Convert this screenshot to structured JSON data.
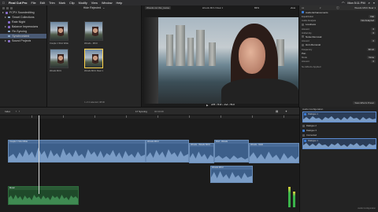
{
  "menubar": {
    "apple": "",
    "items": [
      "Final Cut Pro",
      "File",
      "Edit",
      "Trim",
      "Mark",
      "Clip",
      "Modify",
      "View",
      "Window",
      "Help"
    ],
    "clock": "Mon 5:11 PM"
  },
  "libraries": {
    "items": [
      {
        "label": "FCPX Soundediting",
        "level": 0
      },
      {
        "label": "Smart Collections",
        "level": 1
      },
      {
        "label": "Rate Night",
        "level": 1
      },
      {
        "label": "Balance Impressions",
        "level": 1
      },
      {
        "label": "Re-Syncing",
        "level": 2
      },
      {
        "label": "Synchronized",
        "level": 2
      },
      {
        "label": "Sound Projects",
        "level": 1
      }
    ],
    "selected_index": 5
  },
  "browser": {
    "title": "Hide Rejected",
    "clips": [
      {
        "label": "Couple 1 Shot Wide"
      },
      {
        "label": "Woods - MCU"
      },
      {
        "label": "Woods MCU"
      },
      {
        "label": "Woods MCU Rear 1"
      }
    ],
    "footer": "1 of 4 selected, 08:00"
  },
  "viewer": {
    "zoom": "83%",
    "view_label": "View",
    "title_left": "Woods cut this_louise",
    "title_right": "Woods MCU Rear 1",
    "timecode": "18:53:32:03"
  },
  "inspector": {
    "title": "Woods MCU Rear 1",
    "sections": [
      {
        "type": "head",
        "label": "Audio Enhancements"
      },
      {
        "type": "row",
        "label": "Equalization",
        "value": "Flat"
      },
      {
        "type": "row",
        "label": "Audio Analysis",
        "value": "Not Analyzed"
      },
      {
        "type": "head",
        "label": "Loudness"
      },
      {
        "type": "row",
        "label": "Amount",
        "value": "0"
      },
      {
        "type": "row",
        "label": "Uniformity",
        "value": "0"
      },
      {
        "type": "head",
        "label": "Noise Removal"
      },
      {
        "type": "row",
        "label": "Amount",
        "value": "0"
      },
      {
        "type": "head",
        "label": "Hum Removal"
      },
      {
        "type": "row",
        "label": "Frequency",
        "value": "60 Hz"
      },
      {
        "type": "head",
        "label": "Pan"
      },
      {
        "type": "row",
        "label": "Mode",
        "value": "None"
      },
      {
        "type": "row",
        "label": "Amount",
        "value": "0"
      },
      {
        "type": "head",
        "label": "No Effects Applied"
      }
    ],
    "save_preset": "Save Effects Preset"
  },
  "timeline_bar": {
    "index_label": "Index",
    "project_label": "17 Syncing",
    "duration": "00:00:08"
  },
  "timeline": {
    "clips": [
      {
        "label": "Couple 1 Shot Wide",
        "track": 0
      },
      {
        "label": "Woods MCU",
        "track": 0
      },
      {
        "label": "Woods - Woods MCU",
        "track": 0
      },
      {
        "label": "Rod - Woods",
        "track": 0
      },
      {
        "label": "Woods - Multi",
        "track": 0
      },
      {
        "label": "Woods MCU",
        "track": 1
      },
      {
        "label": "Music",
        "track": 2
      }
    ]
  },
  "audio_config": {
    "title": "Audio Configuration",
    "channels": [
      {
        "label": "Dialogue 1",
        "checked": true
      },
      {
        "label": "Dialogue 2",
        "checked": false
      },
      {
        "label": "Dialogue 3",
        "checked": true
      },
      {
        "label": "Connected",
        "checked": false
      },
      {
        "label": "Dialogue 1",
        "checked": true
      }
    ],
    "footer": "Audio Configuration"
  },
  "colors": {
    "accent": "#3a7bd5",
    "clip_blue": "#3d5f8a",
    "clip_green": "#1f4a2a",
    "selection": "#ffd24a"
  }
}
